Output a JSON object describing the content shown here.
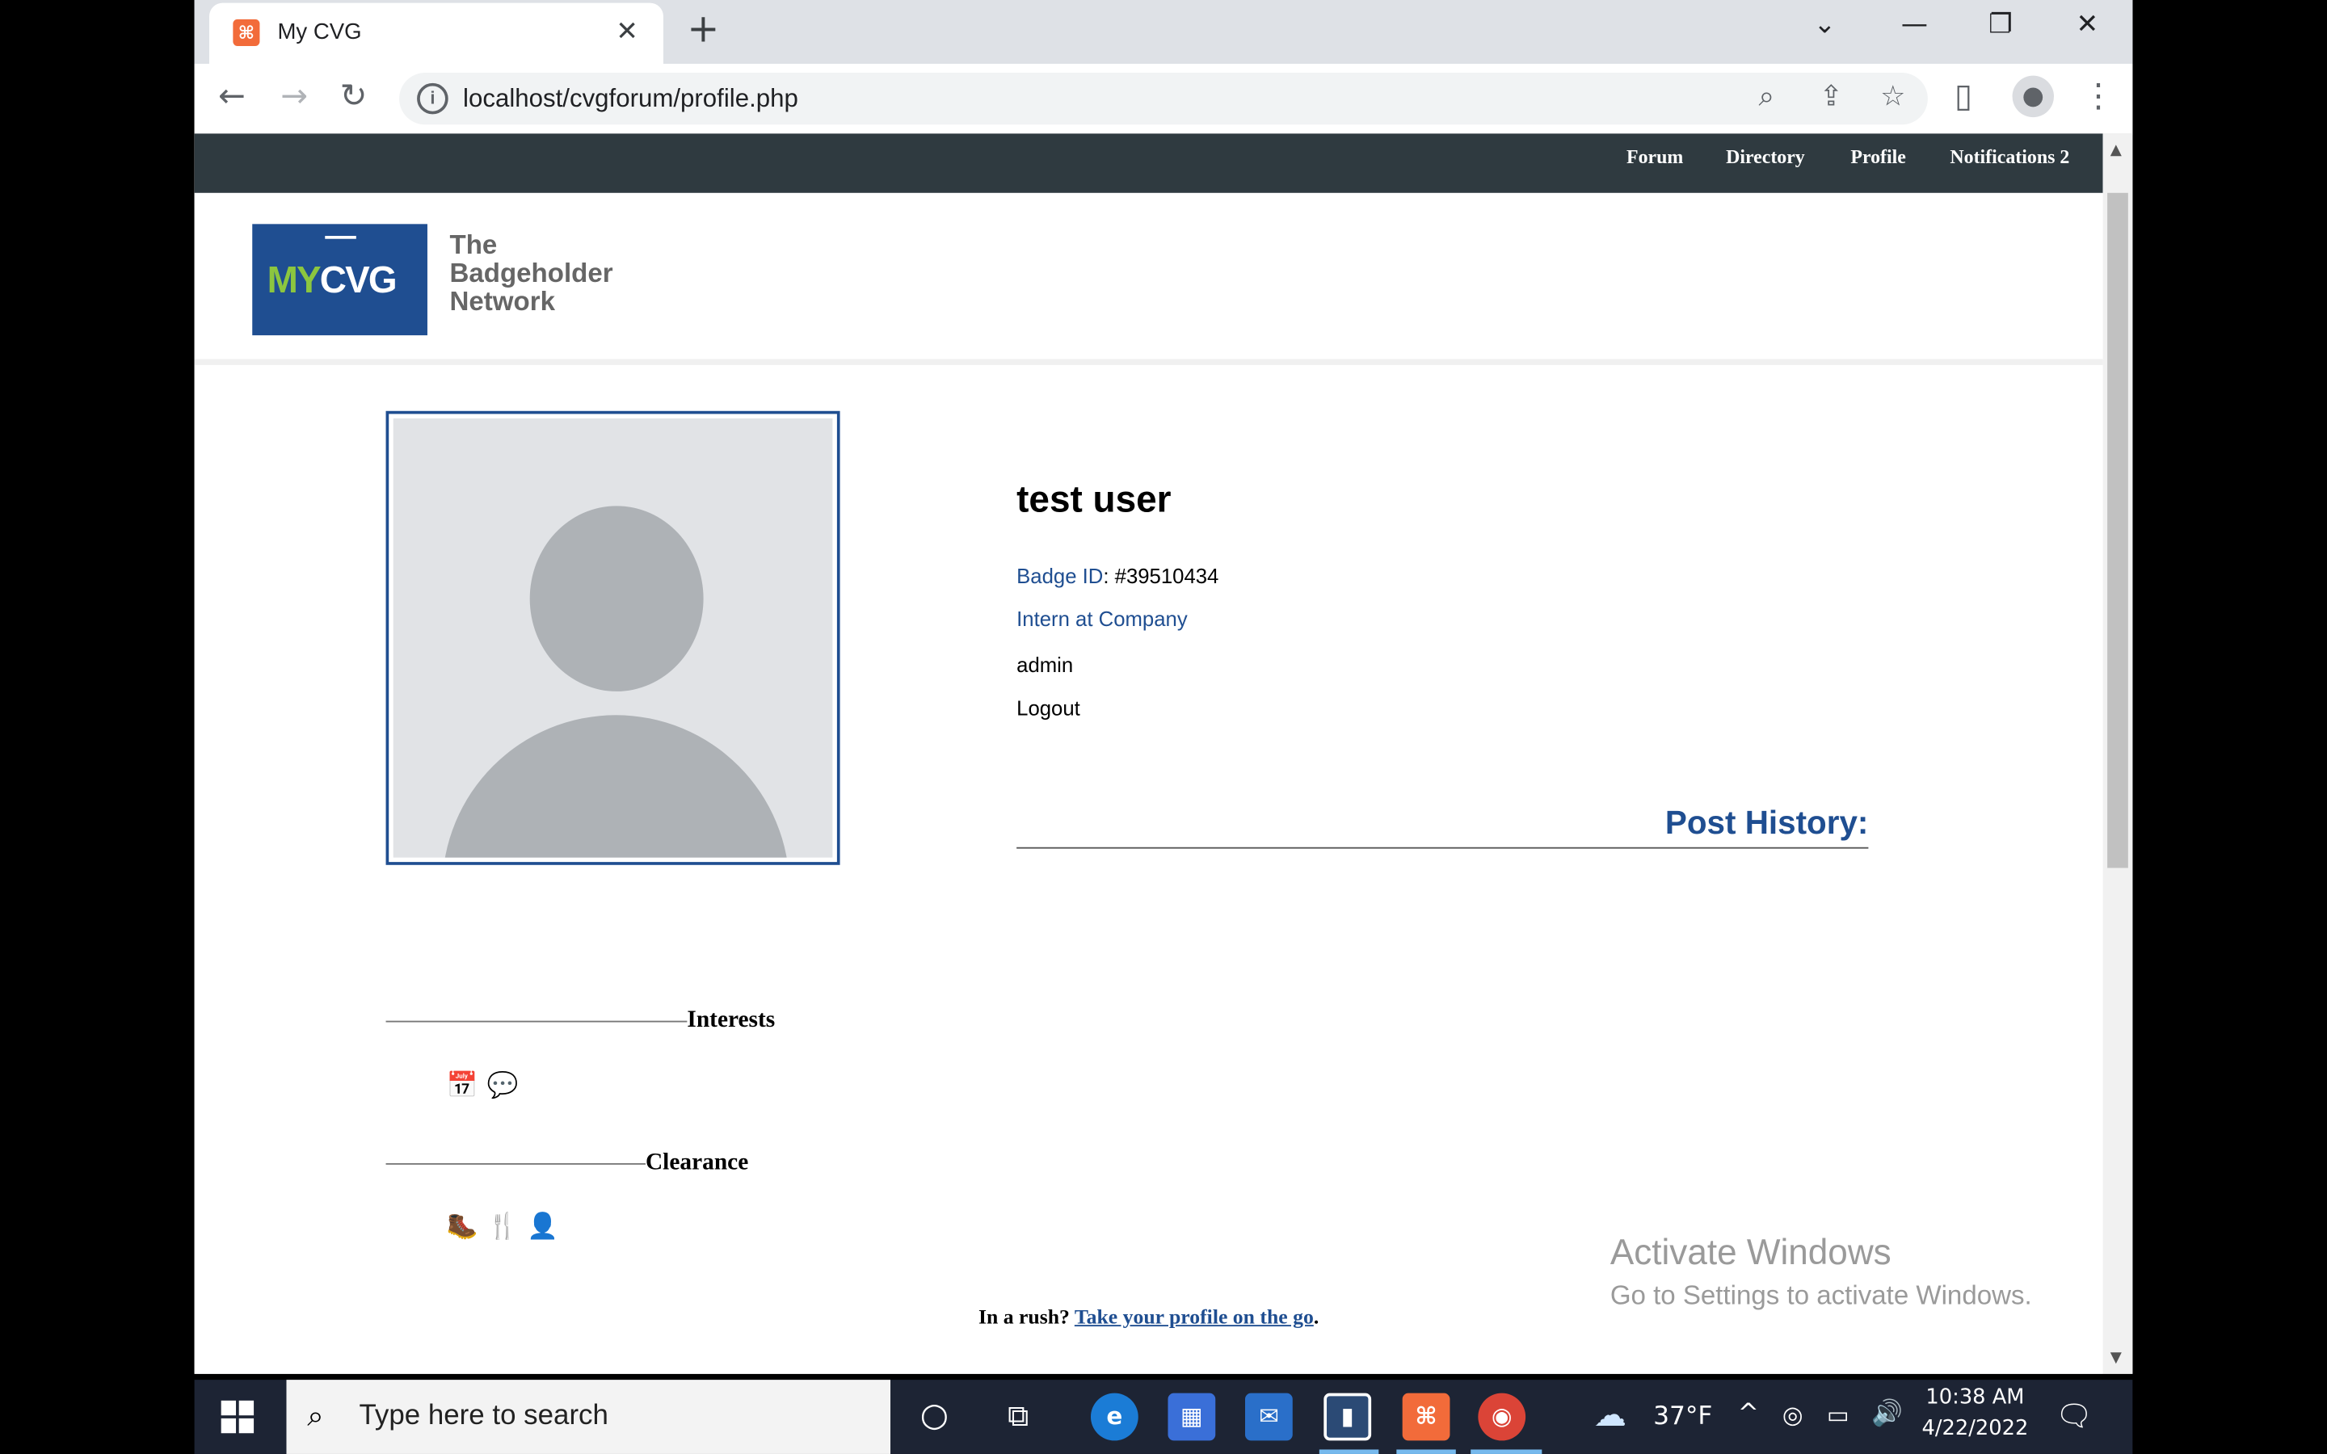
{
  "browser": {
    "tab_title": "My CVG",
    "tab_favicon": "xampp-icon",
    "url": "localhost/cvgforum/profile.php"
  },
  "site_nav": {
    "items": [
      "Forum",
      "Directory",
      "Profile",
      "Notifications 2"
    ]
  },
  "header": {
    "logo_my": "MY",
    "logo_cvg": "CVG",
    "tagline": "The Badgeholder Network"
  },
  "profile": {
    "name": "test user",
    "badge_label": "Badge ID",
    "badge_value": ": #39510434",
    "role": "Intern at Company",
    "group": "admin",
    "logout": "Logout",
    "post_history_title": "Post History:"
  },
  "sections": {
    "interests_title": "Interests",
    "interests_icons": [
      "calendar-download-icon",
      "chat-bubbles-icon"
    ],
    "clearance_title": "Clearance",
    "clearance_icons": [
      "hiking-icon",
      "dining-icon",
      "person-clock-icon"
    ]
  },
  "footer": {
    "prefix": "In a rush? ",
    "link": "Take your profile on the go",
    "suffix": "."
  },
  "watermark": {
    "title": "Activate Windows",
    "subtitle": "Go to Settings to activate Windows."
  },
  "taskbar": {
    "search_placeholder": "Type here to search",
    "weather": "37°F",
    "time": "10:38 AM",
    "date": "4/22/2022"
  },
  "colors": {
    "accent": "#1f4e91",
    "nav_bg": "#2f3a40",
    "logo_green": "#8cc63f"
  }
}
